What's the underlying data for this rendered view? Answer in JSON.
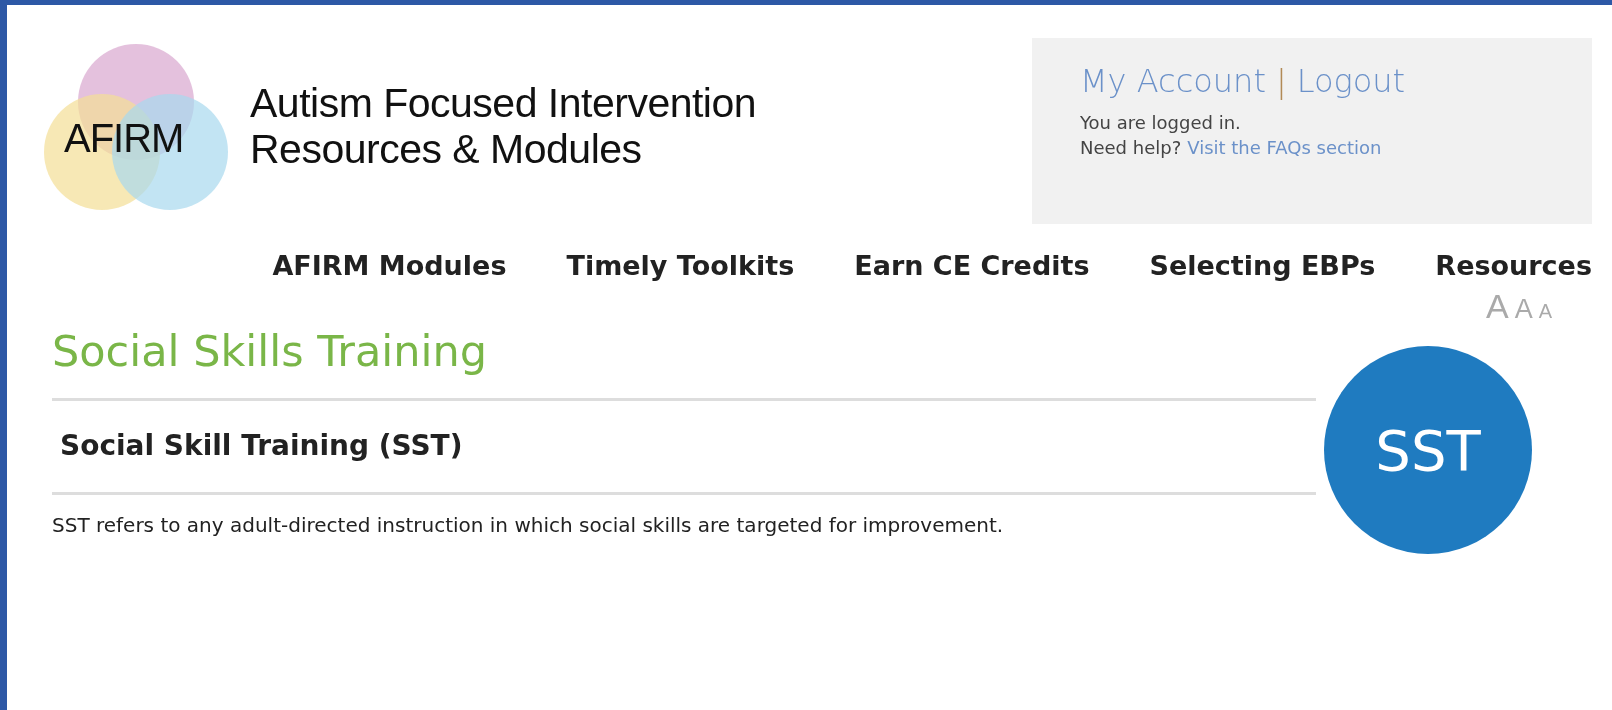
{
  "header": {
    "logo_text": "AFIRM",
    "site_title": [
      "Autism Focused Intervention",
      "Resources & Modules"
    ]
  },
  "account": {
    "links": [
      "My Account",
      "Logout"
    ],
    "separator": "|",
    "status": "You are logged in.",
    "help_prefix": "Need help?",
    "help_link": "Visit the FAQs section"
  },
  "nav": [
    "AFIRM Modules",
    "Timely Toolkits",
    "Earn CE Credits",
    "Selecting EBPs",
    "Resources"
  ],
  "font_size_controls": [
    "A",
    "A",
    "A"
  ],
  "page_title": "Social Skills Training",
  "section": {
    "title": "Social Skill Training (SST)",
    "badge": "SST",
    "description": "SST refers to any adult-directed instruction in which social skills are targeted for improvement."
  }
}
